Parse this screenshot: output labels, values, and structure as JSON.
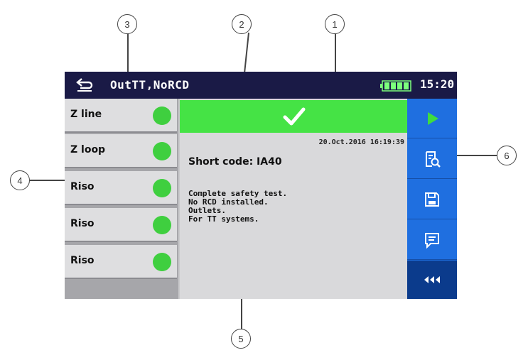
{
  "header": {
    "title": "OutTT,NoRCD",
    "time": "15:20"
  },
  "tests": [
    {
      "label": "Z line",
      "status": "pass"
    },
    {
      "label": "Z loop",
      "status": "pass"
    },
    {
      "label": "Riso",
      "status": "pass"
    },
    {
      "label": "Riso",
      "status": "pass"
    },
    {
      "label": "Riso",
      "status": "pass"
    }
  ],
  "main": {
    "timestamp": "20.Oct.2016 16:19:39",
    "short_code": "Short code: IA40",
    "description": [
      "Complete safety test.",
      "No RCD installed.",
      "Outlets.",
      "For TT systems."
    ]
  },
  "callouts": [
    "1",
    "2",
    "3",
    "4",
    "5",
    "6"
  ],
  "colors": {
    "header_bg": "#1a1a46",
    "pass_green": "#3fcf3f",
    "banner_green": "#45e345",
    "toolbar_blue": "#1f6fe0",
    "collapse_blue": "#0b3b8c"
  }
}
